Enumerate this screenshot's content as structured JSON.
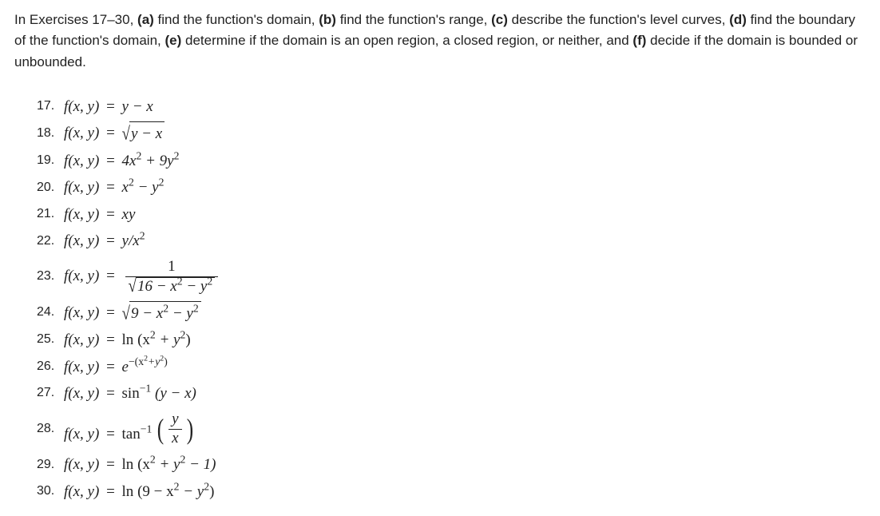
{
  "instructions": {
    "prefix": "In Exercises 17–30, ",
    "a_bold": "(a)",
    "a_text": " find the function's domain, ",
    "b_bold": "(b)",
    "b_text": " find the function's range, ",
    "c_bold": "(c)",
    "c_text": " describe the function's level curves, ",
    "d_bold": "(d)",
    "d_text": " find the boundary of the function's domain, ",
    "e_bold": "(e)",
    "e_text": " determine if the domain is an open region, a closed region, or neither, and ",
    "f_bold": "(f)",
    "f_text": " decide if the domain is bounded or unbounded."
  },
  "exercises": {
    "n17": "17.",
    "n18": "18.",
    "n19": "19.",
    "n20": "20.",
    "n21": "21.",
    "n22": "22.",
    "n23": "23.",
    "n24": "24.",
    "n25": "25.",
    "n26": "26.",
    "n27": "27.",
    "n28": "28.",
    "n29": "29.",
    "n30": "30.",
    "lhs": "f(x, y)",
    "eq": " = ",
    "e17": "y − x",
    "e18_body": "y − x",
    "e19_a": "4x",
    "e19_b": " + 9y",
    "e20_a": "x",
    "e20_b": " − y",
    "e21": "xy",
    "e22": "y/x",
    "e23_num": "1",
    "e23_den_a": "16 − x",
    "e23_den_b": " − y",
    "e24_body_a": "9 − x",
    "e24_body_b": " − y",
    "ln": "ln ",
    "e25_a": "(x",
    "e25_b": " + y",
    "e25_c": ")",
    "e26_e": "e",
    "e26_exp_a": "−(x",
    "e26_exp_b": "+y",
    "e26_exp_c": ")",
    "sin": "sin",
    "e27_inv": "−1",
    "e27_body": " (y − x)",
    "tan": "tan",
    "e28_inv": "−1",
    "e28_frac_num": "y",
    "e28_frac_den": "x",
    "e29_a": "(x",
    "e29_b": " + y",
    "e29_c": " − 1)",
    "e30_a": "(9 − x",
    "e30_b": " − y",
    "e30_c": ")",
    "two": "2"
  }
}
